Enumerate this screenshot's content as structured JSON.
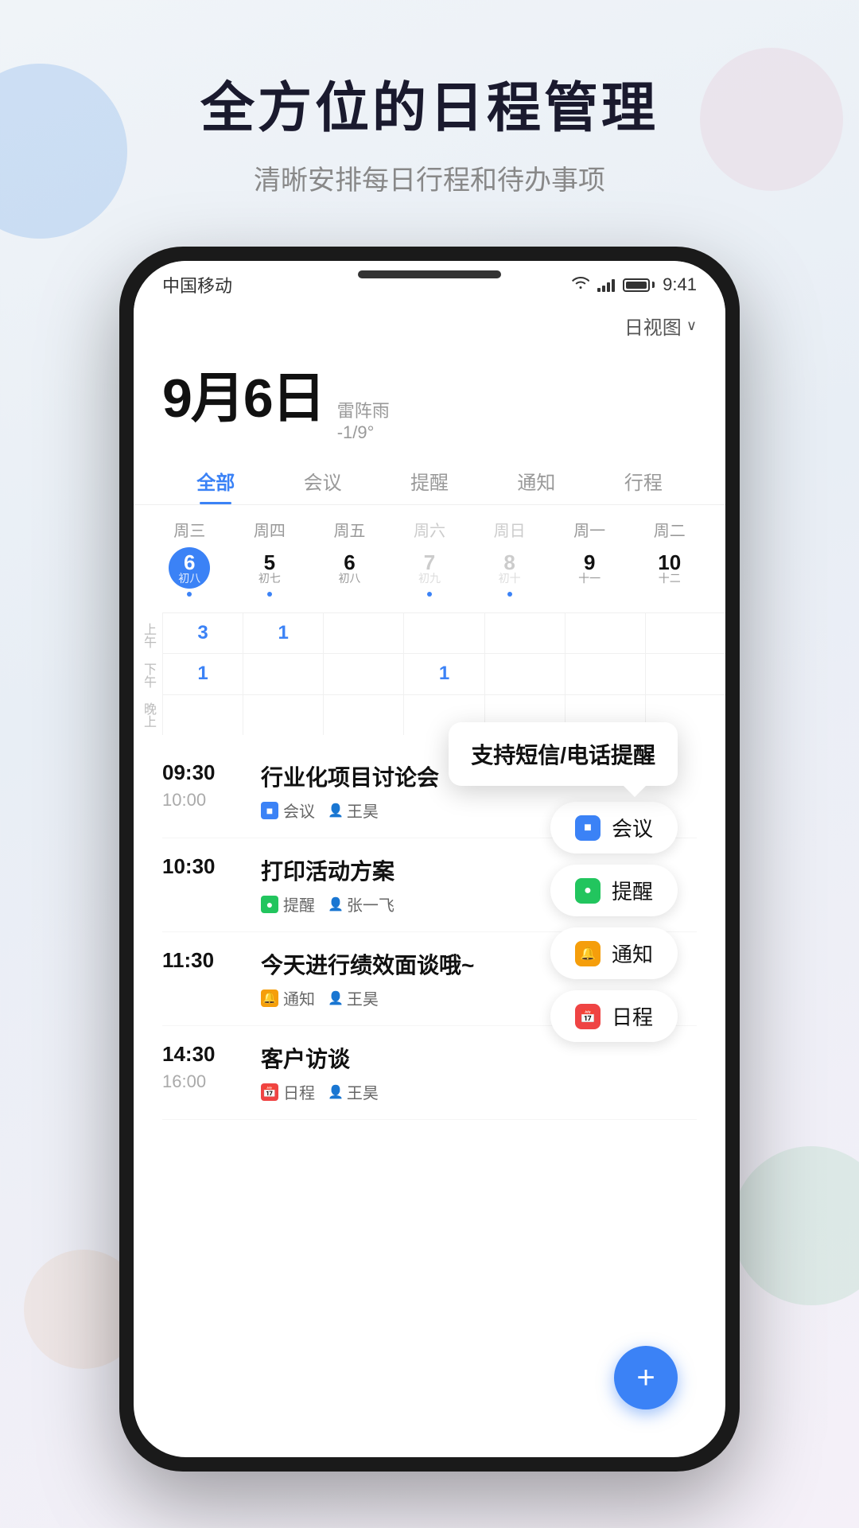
{
  "header": {
    "title": "全方位的日程管理",
    "subtitle": "清晰安排每日行程和待办事项"
  },
  "status_bar": {
    "carrier": "中国移动",
    "time": "9:41",
    "wifi": "WiFi",
    "signal_bars": 4,
    "battery_full": true
  },
  "view_mode": "日视图",
  "date": {
    "month": "9",
    "day": "6",
    "unit": "日",
    "weather": "雷阵雨",
    "temp": "-1/9°"
  },
  "tabs": [
    {
      "label": "全部",
      "active": true
    },
    {
      "label": "会议",
      "active": false
    },
    {
      "label": "提醒",
      "active": false
    },
    {
      "label": "通知",
      "active": false
    },
    {
      "label": "行程",
      "active": false
    }
  ],
  "week_days": [
    {
      "name": "周三",
      "num": "6",
      "lunar": "初八",
      "today": true,
      "dot": true,
      "dim": false
    },
    {
      "name": "周四",
      "num": "5",
      "lunar": "初七",
      "today": false,
      "dot": true,
      "dim": false
    },
    {
      "name": "周五",
      "num": "6",
      "lunar": "初八",
      "today": false,
      "dot": false,
      "dim": false
    },
    {
      "name": "周六",
      "num": "7",
      "lunar": "初九",
      "today": false,
      "dot": true,
      "dim": true
    },
    {
      "name": "周日",
      "num": "8",
      "lunar": "初十",
      "today": false,
      "dot": true,
      "dim": true
    },
    {
      "name": "周一",
      "num": "9",
      "lunar": "十一",
      "today": false,
      "dot": false,
      "dim": false
    },
    {
      "name": "周二",
      "num": "10",
      "lunar": "十二",
      "today": false,
      "dot": false,
      "dim": false
    }
  ],
  "time_sections": [
    "上午",
    "下午",
    "晚上"
  ],
  "grid_counts": {
    "am_col0": "3",
    "am_col1": "1",
    "pm_col0": "1",
    "pm_col3": "1"
  },
  "events": [
    {
      "start": "09:30",
      "end": "10:00",
      "title": "行业化项目讨论会",
      "type": "meeting",
      "type_label": "会议",
      "person": "王昊"
    },
    {
      "start": "10:30",
      "end": "",
      "title": "打印活动方案",
      "type": "reminder",
      "type_label": "提醒",
      "person": "张一飞"
    },
    {
      "start": "11:30",
      "end": "",
      "title": "今天进行绩效面谈哦~",
      "type": "notice",
      "type_label": "通知",
      "person": "王昊"
    },
    {
      "start": "14:30",
      "end": "16:00",
      "title": "客户访谈",
      "type": "schedule",
      "type_label": "日程",
      "person": "王昊"
    }
  ],
  "tooltip": {
    "text": "支持短信/电话提醒"
  },
  "action_buttons": [
    {
      "label": "会议",
      "type": "meeting"
    },
    {
      "label": "提醒",
      "type": "reminder"
    },
    {
      "label": "通知",
      "type": "notice"
    },
    {
      "label": "日程",
      "type": "schedule"
    }
  ],
  "fab_label": "+",
  "colors": {
    "primary": "#3b82f6",
    "meeting": "#3b82f6",
    "reminder": "#22c55e",
    "notice": "#f59e0b",
    "schedule": "#ef4444"
  }
}
